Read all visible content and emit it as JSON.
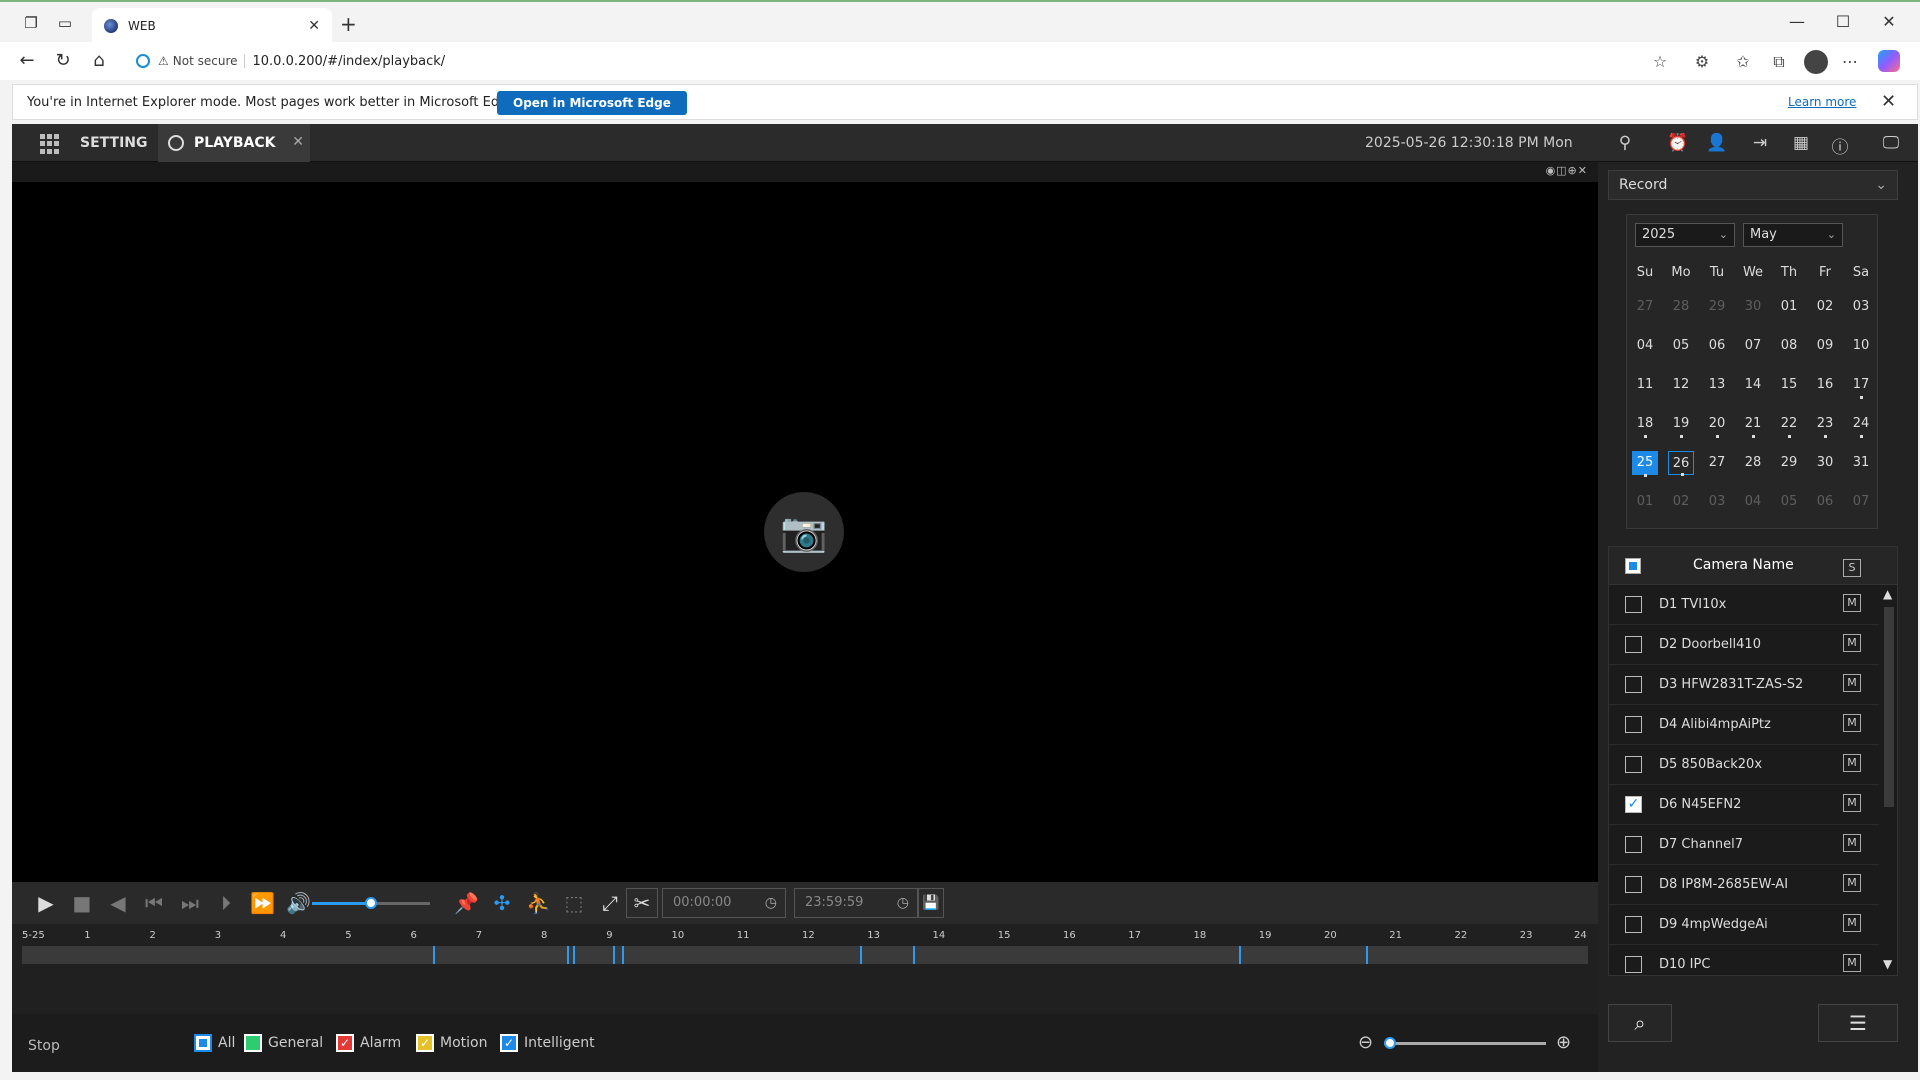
{
  "browser": {
    "tab_title": "WEB",
    "not_secure": "Not secure",
    "url": "10.0.0.200/#/index/playback/",
    "ie_message": "You're in Internet Explorer mode. Most pages work better in Microsoft Edge.",
    "ie_open_button": "Open in Microsoft Edge",
    "ie_learn_more": "Learn more"
  },
  "app": {
    "nav_setting": "SETTING",
    "nav_playback": "PLAYBACK",
    "datetime": "2025-05-26 12:30:18 PM Mon",
    "start_time": "00:00:00",
    "end_time": "23:59:59",
    "status": "Stop",
    "volume_level": 0.5,
    "timeline_zoom_level": 0.0,
    "timeline_labels": [
      "5-25",
      "1",
      "2",
      "3",
      "4",
      "5",
      "6",
      "7",
      "8",
      "9",
      "10",
      "11",
      "12",
      "13",
      "14",
      "15",
      "16",
      "17",
      "18",
      "19",
      "20",
      "21",
      "22",
      "23",
      "24"
    ],
    "timeline_marks_hours": [
      6.3,
      8.35,
      8.45,
      9.05,
      9.2,
      12.85,
      13.65,
      18.65,
      20.6
    ],
    "legend": [
      {
        "label": "All",
        "color": "#1c8ae6",
        "checked": true
      },
      {
        "label": "General",
        "color": "#2ecc71",
        "checked": false
      },
      {
        "label": "Alarm",
        "color": "#e53935",
        "checked": true
      },
      {
        "label": "Motion",
        "color": "#e5c227",
        "checked": true
      },
      {
        "label": "Intelligent",
        "color": "#1c8ae6",
        "checked": true
      }
    ]
  },
  "panel": {
    "record_select": "Record",
    "year": "2025",
    "month": "May",
    "dow": [
      "Su",
      "Mo",
      "Tu",
      "We",
      "Th",
      "Fr",
      "Sa"
    ],
    "weeks": [
      [
        [
          "27",
          "muted"
        ],
        [
          "28",
          "muted"
        ],
        [
          "29",
          "muted"
        ],
        [
          "30",
          "muted"
        ],
        [
          "01",
          ""
        ],
        [
          "02",
          ""
        ],
        [
          "03",
          ""
        ]
      ],
      [
        [
          "04",
          ""
        ],
        [
          "05",
          ""
        ],
        [
          "06",
          ""
        ],
        [
          "07",
          ""
        ],
        [
          "08",
          ""
        ],
        [
          "09",
          ""
        ],
        [
          "10",
          ""
        ]
      ],
      [
        [
          "11",
          ""
        ],
        [
          "12",
          ""
        ],
        [
          "13",
          ""
        ],
        [
          "14",
          ""
        ],
        [
          "15",
          ""
        ],
        [
          "16",
          ""
        ],
        [
          "17",
          "has"
        ]
      ],
      [
        [
          "18",
          "has"
        ],
        [
          "19",
          "has"
        ],
        [
          "20",
          "has"
        ],
        [
          "21",
          "has"
        ],
        [
          "22",
          "has"
        ],
        [
          "23",
          "has"
        ],
        [
          "24",
          "has"
        ]
      ],
      [
        [
          "25",
          "sel has"
        ],
        [
          "26",
          "today has"
        ],
        [
          "27",
          ""
        ],
        [
          "28",
          ""
        ],
        [
          "29",
          ""
        ],
        [
          "30",
          ""
        ],
        [
          "31",
          ""
        ]
      ],
      [
        [
          "01",
          "muted"
        ],
        [
          "02",
          "muted"
        ],
        [
          "03",
          "muted"
        ],
        [
          "04",
          "muted"
        ],
        [
          "05",
          "muted"
        ],
        [
          "06",
          "muted"
        ],
        [
          "07",
          "muted"
        ]
      ]
    ],
    "camera_header": "Camera Name",
    "s_label": "S",
    "m_label": "M",
    "cameras": [
      {
        "name": "D1 TVI10x",
        "checked": false
      },
      {
        "name": "D2 Doorbell410",
        "checked": false
      },
      {
        "name": "D3 HFW2831T-ZAS-S2",
        "checked": false
      },
      {
        "name": "D4 Alibi4mpAiPtz",
        "checked": false
      },
      {
        "name": "D5 850Back20x",
        "checked": false
      },
      {
        "name": "D6 N45EFN2",
        "checked": true
      },
      {
        "name": "D7 Channel7",
        "checked": false
      },
      {
        "name": "D8 IP8M-2685EW-AI",
        "checked": false
      },
      {
        "name": "D9 4mpWedgeAi",
        "checked": false
      },
      {
        "name": "D10 IPC",
        "checked": false
      }
    ]
  }
}
